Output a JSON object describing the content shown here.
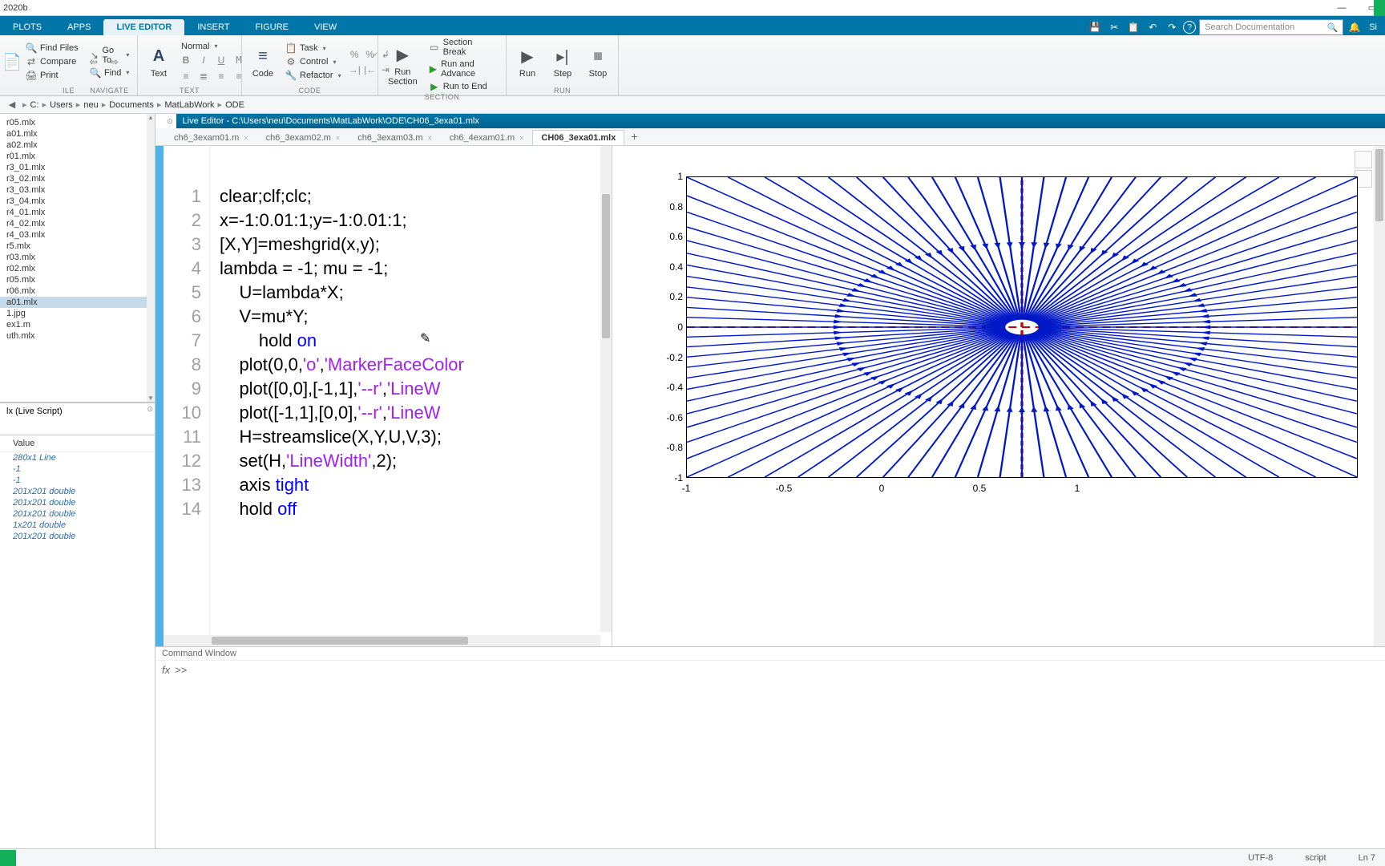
{
  "window": {
    "title": "2020b"
  },
  "tabs": {
    "items": [
      "PLOTS",
      "APPS",
      "LIVE EDITOR",
      "INSERT",
      "FIGURE",
      "VIEW"
    ],
    "active": "LIVE EDITOR",
    "search_placeholder": "Search Documentation",
    "sign": "Si"
  },
  "toolstrip": {
    "file": {
      "label": "ILE",
      "find_files": "Find Files",
      "compare": "Compare",
      "print": "Print"
    },
    "navigate": {
      "label": "NAVIGATE",
      "goto": "Go To",
      "find": "Find"
    },
    "text": {
      "label": "TEXT",
      "text_btn": "Text",
      "normal": "Normal"
    },
    "code": {
      "label": "CODE",
      "code_btn": "Code",
      "task": "Task",
      "control": "Control",
      "refactor": "Refactor"
    },
    "section": {
      "label": "SECTION",
      "run_section": "Run\nSection",
      "section_break": "Section Break",
      "run_and_advance": "Run and Advance",
      "run_to_end": "Run to End"
    },
    "run": {
      "label": "RUN",
      "run": "Run",
      "step": "Step",
      "stop": "Stop"
    }
  },
  "path": {
    "segments": [
      "C:",
      "Users",
      "neu",
      "Documents",
      "MatLabWork",
      "ODE"
    ]
  },
  "folder": {
    "items": [
      "r05.mlx",
      "a01.mlx",
      "a02.mlx",
      "r01.mlx",
      "r3_01.mlx",
      "r3_02.mlx",
      "r3_03.mlx",
      "r3_04.mlx",
      "r4_01.mlx",
      "r4_02.mlx",
      "r4_03.mlx",
      "r5.mlx",
      "r03.mlx",
      "r02.mlx",
      "r05.mlx",
      "r06.mlx",
      "a01.mlx",
      "1.jpg",
      "ex1.m",
      "uth.mlx"
    ],
    "selected": 16,
    "details": "lx   (Live Script)"
  },
  "folder_icons": {
    "scroll_up": "▲",
    "scroll_down": "▼",
    "expand": "⊙"
  },
  "workspace": {
    "header": "Value",
    "rows": [
      "280x1 Line",
      "-1",
      "-1",
      "201x201 double",
      "201x201 double",
      "201x201 double",
      "1x201 double",
      "201x201 double"
    ]
  },
  "editor": {
    "title": "Live Editor - C:\\Users\\neu\\Documents\\MatLabWork\\ODE\\CH06_3exa01.mlx",
    "tabs": [
      "ch6_3exam01.m",
      "ch6_3exam02.m",
      "ch6_3exam03.m",
      "ch6_4exam01.m",
      "CH06_3exa01.mlx"
    ],
    "active_tab": 4,
    "lines": [
      "clear;clf;clc;",
      "x=-1:0.01:1;y=-1:0.01:1;",
      "[X,Y]=meshgrid(x,y);",
      "lambda = -1; mu = -1;",
      "    U=lambda*X;",
      "    V=mu*Y;",
      "        hold on",
      "    plot(0,0,'o','MarkerFaceColor",
      "    plot([0,0],[-1,1],'--r','LineW",
      "    plot([-1,1],[0,0],'--r','LineW",
      "    H=streamslice(X,Y,U,V,3);",
      "    set(H,'LineWidth',2);",
      "    axis tight",
      "    hold off"
    ]
  },
  "chart_data": {
    "type": "streamslice",
    "description": "Phase-plane streamlines for dx/dt = -x, dy/dt = -y (stable node at origin)",
    "xlim": [
      -1,
      1
    ],
    "ylim": [
      -1,
      1
    ],
    "xticks": [
      -1,
      -0.5,
      0,
      0.5,
      1
    ],
    "yticks": [
      -1,
      -0.8,
      -0.6,
      -0.4,
      -0.2,
      0,
      0.2,
      0.4,
      0.6,
      0.8,
      1
    ],
    "nullclines": [
      {
        "x": [
          0,
          0
        ],
        "y": [
          -1,
          1
        ],
        "style": "--r"
      },
      {
        "x": [
          -1,
          1
        ],
        "y": [
          0,
          0
        ],
        "style": "--r"
      }
    ],
    "fixed_point": {
      "x": 0,
      "y": 0
    },
    "arrows": "inward radial toward origin"
  },
  "cmdwin": {
    "title": "Command Window",
    "prompt": ">>",
    "fx": "fx"
  },
  "status": {
    "encoding": "UTF-8",
    "mode": "script",
    "pos": "Ln  7"
  }
}
